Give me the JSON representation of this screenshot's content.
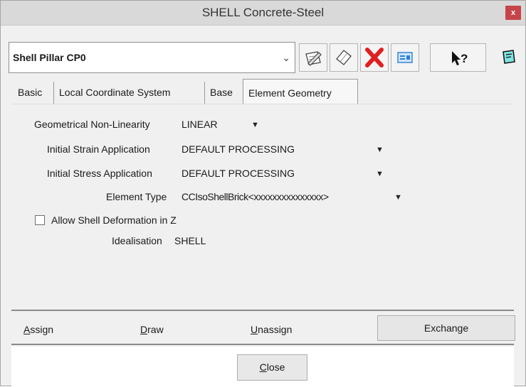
{
  "window": {
    "title": "SHELL Concrete-Steel",
    "close_glyph": "x"
  },
  "selector": {
    "value": "Shell Pillar CP0",
    "arrow_glyph": "⌄"
  },
  "toolbar": {
    "icons": [
      "edit-icon",
      "eraser-icon",
      "delete-icon",
      "view-icon",
      "help-pointer-icon",
      "note-icon"
    ],
    "help_glyph": "?"
  },
  "tabs": [
    {
      "label": "Basic"
    },
    {
      "label": "Local Coordinate System"
    },
    {
      "label": "Base"
    },
    {
      "label": "Element Geometry",
      "active": true
    }
  ],
  "form": {
    "nonlinearity": {
      "label": "Geometrical Non-Linearity",
      "value": "LINEAR"
    },
    "strain": {
      "label": "Initial Strain Application",
      "value": "DEFAULT PROCESSING"
    },
    "stress": {
      "label": "Initial Stress Application",
      "value": "DEFAULT PROCESSING"
    },
    "element_type": {
      "label": "Element Type",
      "value": "CCIsoShellBrick<xxxxxxxxxxxxxxx>"
    },
    "allow_deformation": {
      "label": "Allow Shell Deformation in Z",
      "checked": false
    },
    "idealisation": {
      "label": "Idealisation",
      "value": "SHELL"
    },
    "dropdown_glyph": "▼"
  },
  "actions": {
    "assign": {
      "first": "A",
      "rest": "ssign"
    },
    "draw": {
      "first": "D",
      "rest": "raw"
    },
    "unassign": {
      "first": "U",
      "rest": "nassign"
    },
    "exchange": "Exchange"
  },
  "footer": {
    "close": {
      "first": "C",
      "rest": "lose"
    }
  },
  "colors": {
    "close_red": "#c6454a",
    "delete_red": "#e02020",
    "accent_blue": "#2a7fd4"
  }
}
